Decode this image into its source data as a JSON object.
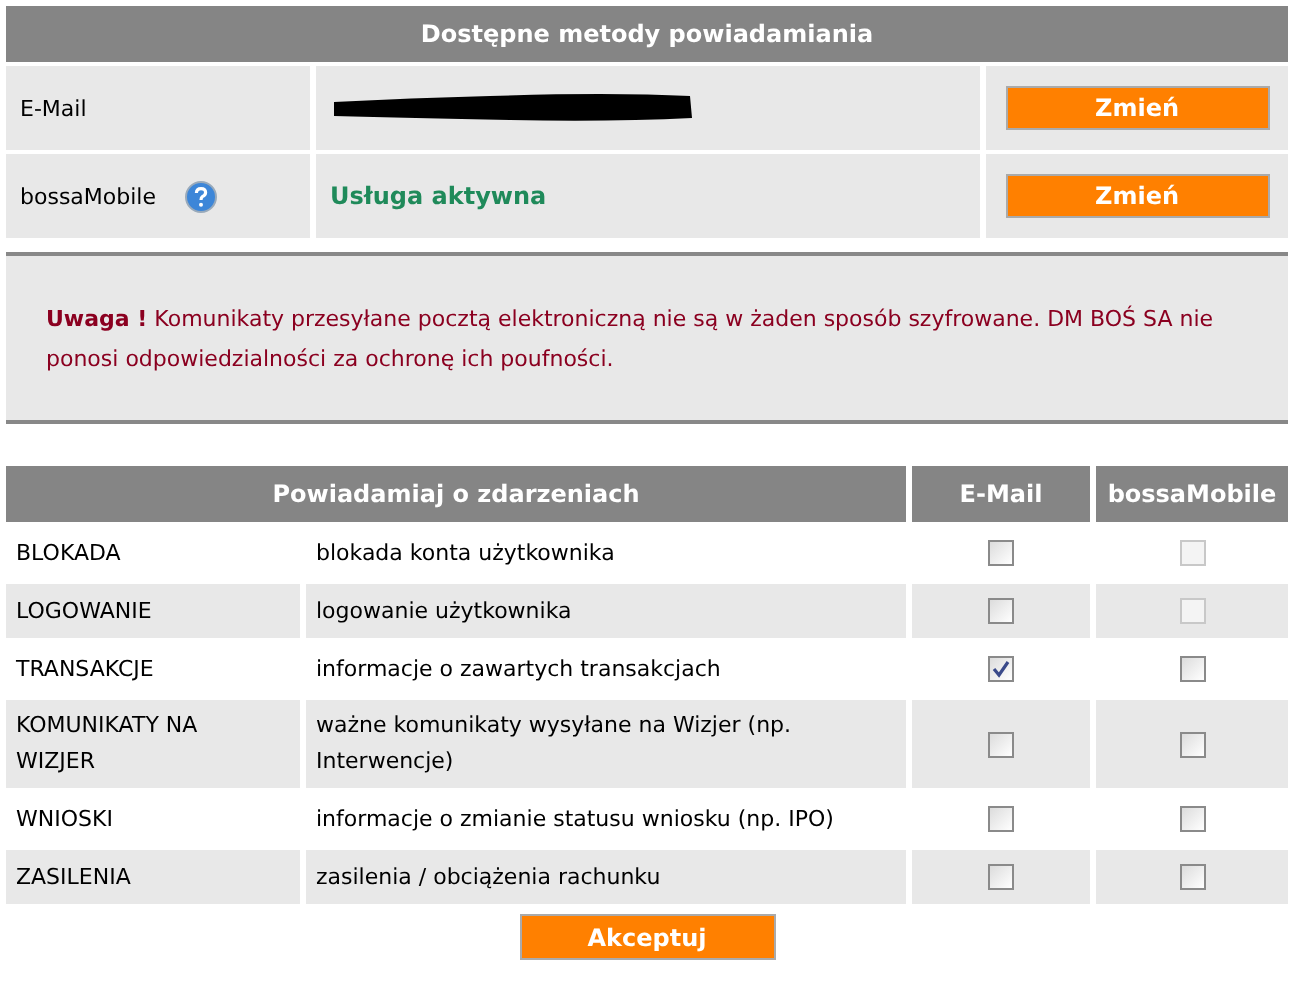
{
  "methods": {
    "title": "Dostępne metody powiadamiania",
    "rows": [
      {
        "label": "E-Mail",
        "kind": "redacted",
        "help": false,
        "button": "Zmień"
      },
      {
        "label": "bossaMobile",
        "kind": "status",
        "help": true,
        "status": "Usługa aktywna",
        "button": "Zmień"
      }
    ]
  },
  "warning": {
    "text": "**Uwaga !** Komunikaty przesyłane pocztą elektroniczną nie są w żaden sposób szyfrowane. DM BOŚ SA nie ponosi odpowiedzialności za ochronę ich poufności."
  },
  "events": {
    "columns": [
      "Powiadamiaj o zdarzeniach",
      "E-Mail",
      "bossaMobile"
    ],
    "rows": [
      {
        "name": "BLOKADA",
        "description": "blokada konta użytkownika",
        "email": {
          "checked": false,
          "disabled": false
        },
        "mobile": {
          "checked": false,
          "disabled": true
        }
      },
      {
        "name": "LOGOWANIE",
        "description": "logowanie użytkownika",
        "email": {
          "checked": false,
          "disabled": false
        },
        "mobile": {
          "checked": false,
          "disabled": true
        }
      },
      {
        "name": "TRANSAKCJE",
        "description": "informacje o zawartych transakcjach",
        "email": {
          "checked": true,
          "disabled": false
        },
        "mobile": {
          "checked": false,
          "disabled": false
        }
      },
      {
        "name": "KOMUNIKATY NA WIZJER",
        "description": "ważne komunikaty wysyłane na Wizjer (np. Interwencje)",
        "email": {
          "checked": false,
          "disabled": false
        },
        "mobile": {
          "checked": false,
          "disabled": false
        }
      },
      {
        "name": "WNIOSKI",
        "description": "informacje o zmianie statusu wniosku (np. IPO)",
        "email": {
          "checked": false,
          "disabled": false
        },
        "mobile": {
          "checked": false,
          "disabled": false
        }
      },
      {
        "name": "ZASILENIA",
        "description": "zasilenia / obciążenia rachunku",
        "email": {
          "checked": false,
          "disabled": false
        },
        "mobile": {
          "checked": false,
          "disabled": false
        }
      }
    ]
  },
  "submit": "Akceptuj"
}
